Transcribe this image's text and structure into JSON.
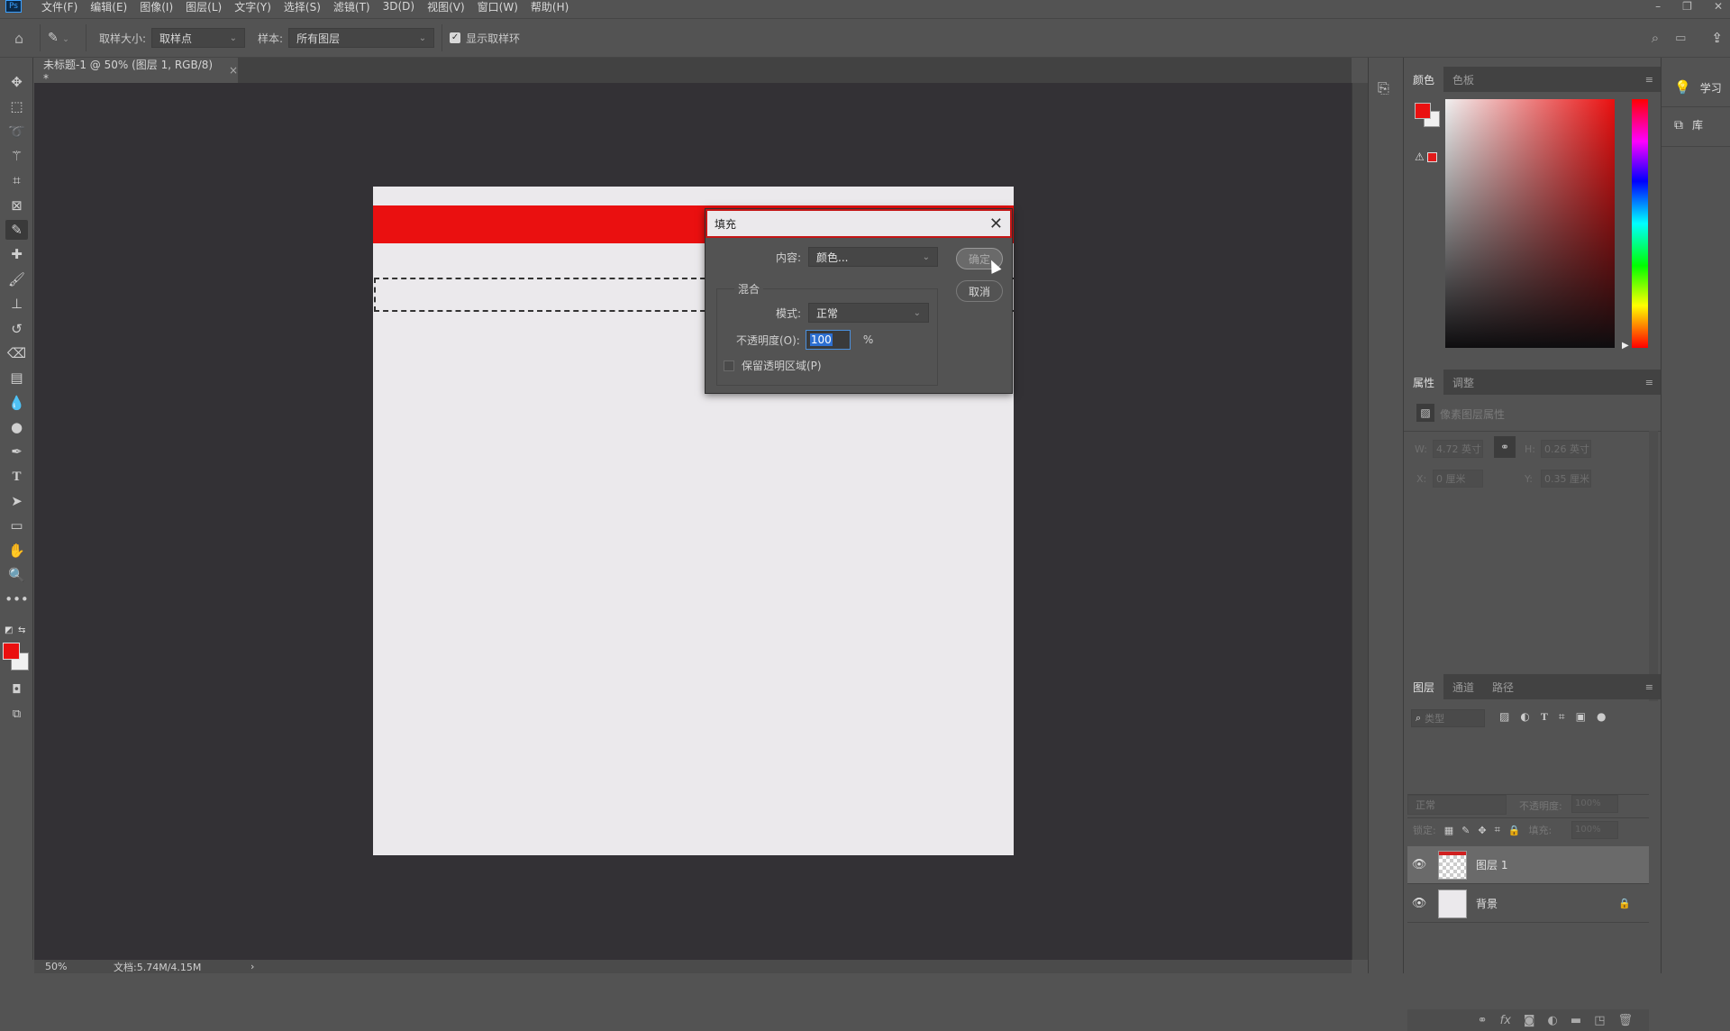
{
  "app": {
    "logo": "Ps",
    "window_controls": [
      "–",
      "❐",
      "✕"
    ]
  },
  "menu": [
    "文件(F)",
    "编辑(E)",
    "图像(I)",
    "图层(L)",
    "文字(Y)",
    "选择(S)",
    "滤镜(T)",
    "3D(D)",
    "视图(V)",
    "窗口(W)",
    "帮助(H)"
  ],
  "options": {
    "sample_size_label": "取样大小:",
    "sample_size_value": "取样点",
    "sample_label": "样本:",
    "sample_value": "所有图层",
    "show_ring_label": "显示取样环",
    "show_ring_checked": true
  },
  "document": {
    "tab_title": "未标题-1 @ 50% (图层 1, RGB/8) *",
    "close": "×",
    "canvas_color": "#ebe9ec",
    "fill_bar_color": "#ea1010"
  },
  "status": {
    "zoom": "50%",
    "doc_info": "文档:5.74M/4.15M",
    "arrow": "›"
  },
  "dialog": {
    "title": "填充",
    "close": "✕",
    "content_label": "内容:",
    "content_value": "颜色...",
    "blend_label": "混合",
    "mode_label": "模式:",
    "mode_value": "正常",
    "opacity_label": "不透明度(O):",
    "opacity_value": "100",
    "opacity_unit": "%",
    "preserve_label": "保留透明区域(P)",
    "preserve_checked": false,
    "ok": "确定",
    "cancel": "取消"
  },
  "tools": [
    "move",
    "marquee",
    "lasso",
    "magic-wand",
    "crop",
    "frame",
    "eyedropper",
    "healing",
    "brush",
    "stamp",
    "history-brush",
    "eraser",
    "gradient",
    "blur",
    "dodge",
    "pen",
    "type",
    "path-select",
    "rectangle",
    "hand",
    "zoom",
    "more"
  ],
  "colors": {
    "foreground": "#ea1010",
    "background": "#f0f0f0"
  },
  "color_panel": {
    "tabs": [
      "颜色",
      "色板"
    ],
    "active": 0
  },
  "learn_panel": {
    "learn": "学习",
    "libraries": "库"
  },
  "properties_panel": {
    "tabs": [
      "属性",
      "调整"
    ],
    "active": 0,
    "heading": "像素图层属性",
    "w_label": "W:",
    "w_value": "4.72 英寸",
    "h_label": "H:",
    "h_value": "0.26 英寸",
    "x_label": "X:",
    "x_value": "0 厘米",
    "y_label": "Y:",
    "y_value": "0.35 厘米"
  },
  "layers_panel": {
    "tabs": [
      "图层",
      "通道",
      "路径"
    ],
    "active": 0,
    "filter_placeholder": "类型",
    "blend_mode": "正常",
    "opacity_label": "不透明度:",
    "opacity_value": "100%",
    "lock_label": "锁定:",
    "fill_label": "填充:",
    "fill_value": "100%",
    "layers": [
      {
        "name": "图层 1",
        "visible": true,
        "selected": true,
        "locked": false
      },
      {
        "name": "背景",
        "visible": true,
        "selected": false,
        "locked": true
      }
    ]
  }
}
